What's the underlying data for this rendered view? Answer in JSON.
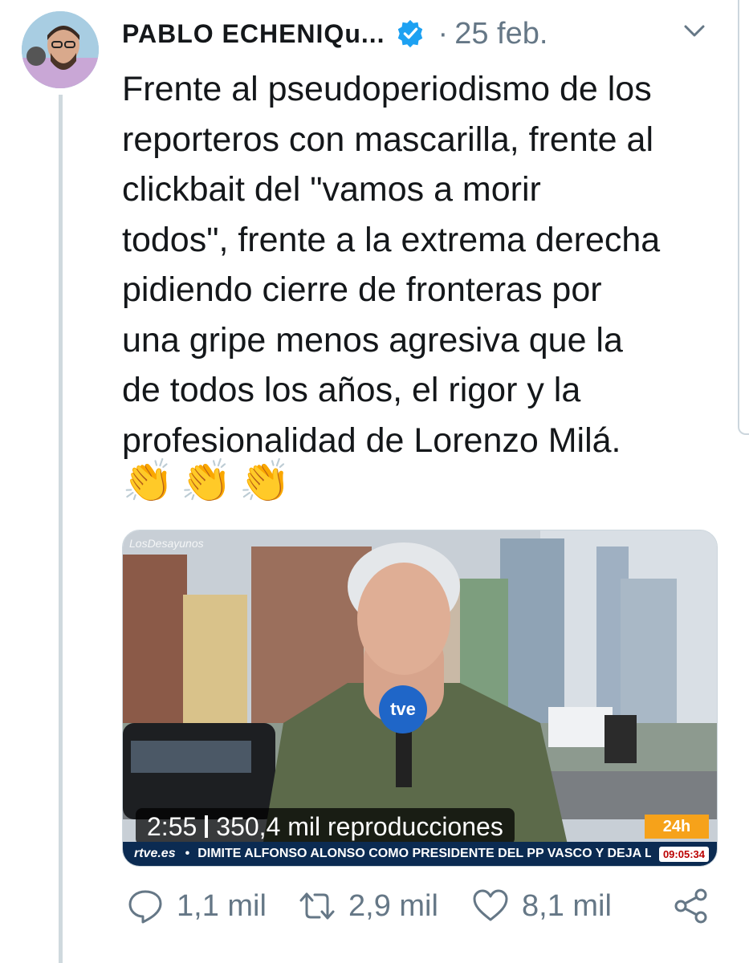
{
  "tweet": {
    "author_name": "PABLO ECHENIQu...",
    "date": "25 feb.",
    "separator": "·",
    "body_lines": [
      "Frente al pseudoperiodismo de los",
      "reporteros con mascarilla, frente al",
      "clickbait del \"vamos a morir",
      "todos\", frente a la extrema derecha",
      "pidiendo cierre de fronteras por",
      "una gripe menos agresiva que la",
      "de todos los años, el rigor y la",
      "profesionalidad de Lorenzo Milá."
    ],
    "emojis": [
      "👏",
      "👏",
      "👏"
    ]
  },
  "media": {
    "watermark": "LosDesayunos",
    "duration": "2:55",
    "views": "350,4 mil reproducciones",
    "channel_badge": "24h",
    "mic_label": "tve",
    "ticker_logo": "rtve.es",
    "ticker_bullet": "•",
    "ticker_text": "DIMITE ALFONSO ALONSO COMO PRESIDENTE DEL PP VASCO Y DEJA LA PO",
    "ticker_clock": "09:05:34"
  },
  "actions": {
    "replies": "1,1 mil",
    "retweets": "2,9 mil",
    "likes": "8,1 mil"
  },
  "colors": {
    "verified": "#1da1f2",
    "muted": "#657786",
    "thread_line": "#cfd9de"
  },
  "icons": [
    "verified-badge-icon",
    "chevron-down-icon",
    "reply-icon",
    "retweet-icon",
    "like-icon",
    "share-icon"
  ]
}
